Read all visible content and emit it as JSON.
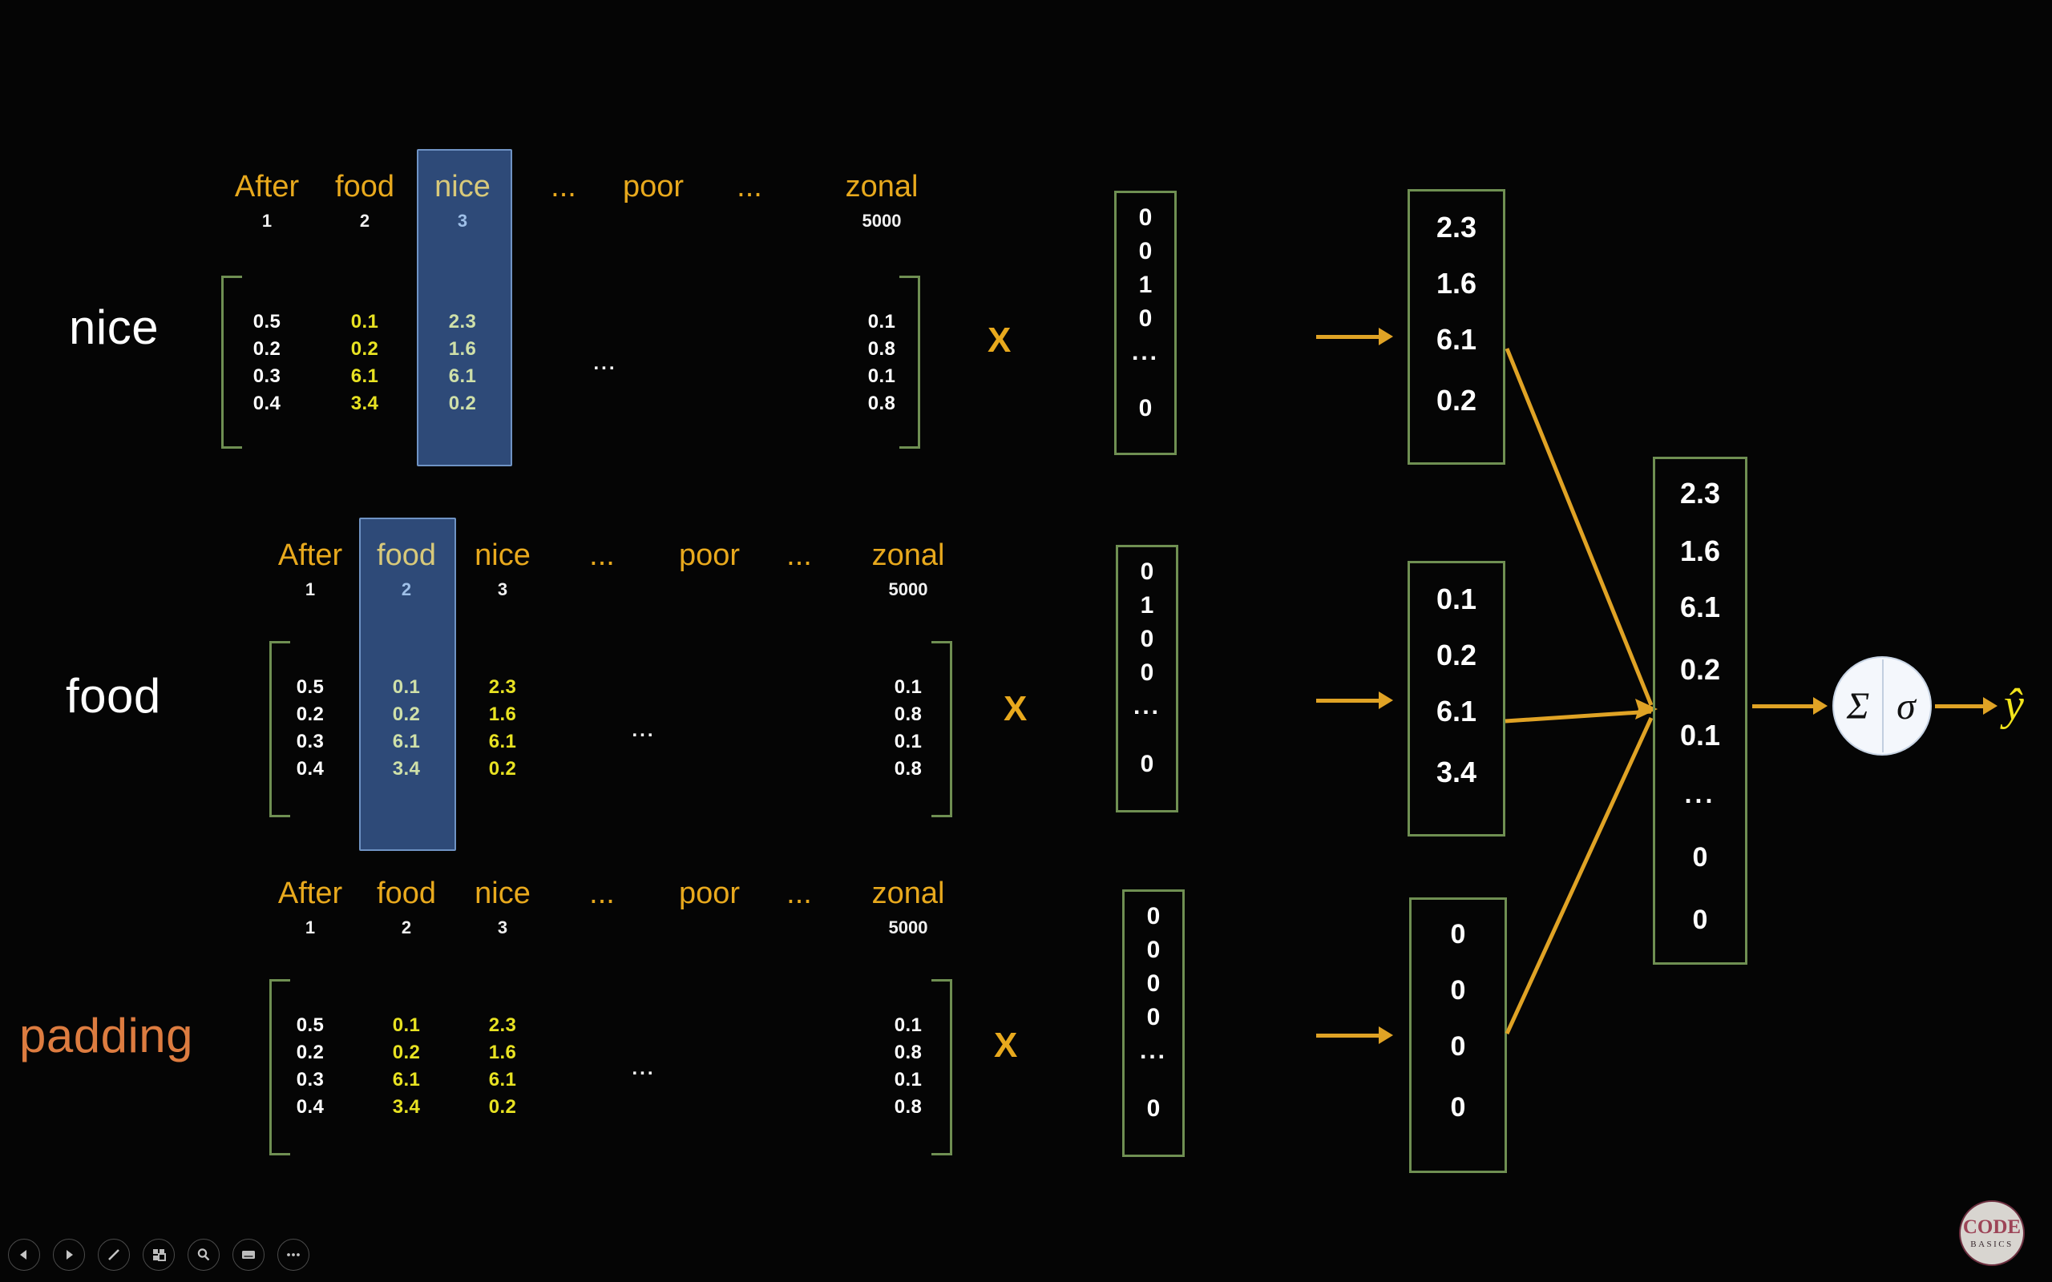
{
  "slide": {
    "background_color": "#000000",
    "accent_gold": "#e8a91d",
    "accent_yellow": "#e8e222",
    "bracket_green": "#6f8f52",
    "highlight_blue": "#2e4a78",
    "padding_orange": "#dd7c40"
  },
  "rows": [
    {
      "label": "nice",
      "label_color": "#ffffff",
      "highlight_index": 2,
      "headers": [
        {
          "word": "After",
          "index": "1"
        },
        {
          "word": "food",
          "index": "2"
        },
        {
          "word": "nice",
          "index": "3"
        },
        {
          "word": "...",
          "index": ""
        },
        {
          "word": "poor",
          "index": ""
        },
        {
          "word": "...",
          "index": ""
        },
        {
          "word": "zonal",
          "index": "5000"
        }
      ],
      "matrix": {
        "col_after": [
          "0.5",
          "0.2",
          "0.3",
          "0.4"
        ],
        "col_food": [
          "0.1",
          "0.2",
          "6.1",
          "3.4"
        ],
        "col_nice": [
          "2.3",
          "1.6",
          "6.1",
          "0.2"
        ],
        "ellipsis": "...",
        "col_zonal": [
          "0.1",
          "0.8",
          "0.1",
          "0.8"
        ]
      },
      "multiply_symbol": "X",
      "onehot": [
        "0",
        "0",
        "1",
        "0",
        "...",
        "0"
      ],
      "embedding": [
        "2.3",
        "1.6",
        "6.1",
        "0.2"
      ]
    },
    {
      "label": "food",
      "label_color": "#ffffff",
      "highlight_index": 1,
      "headers": [
        {
          "word": "After",
          "index": "1"
        },
        {
          "word": "food",
          "index": "2"
        },
        {
          "word": "nice",
          "index": "3"
        },
        {
          "word": "...",
          "index": ""
        },
        {
          "word": "poor",
          "index": ""
        },
        {
          "word": "...",
          "index": ""
        },
        {
          "word": "zonal",
          "index": "5000"
        }
      ],
      "matrix": {
        "col_after": [
          "0.5",
          "0.2",
          "0.3",
          "0.4"
        ],
        "col_food": [
          "0.1",
          "0.2",
          "6.1",
          "3.4"
        ],
        "col_nice": [
          "2.3",
          "1.6",
          "6.1",
          "0.2"
        ],
        "ellipsis": "...",
        "col_zonal": [
          "0.1",
          "0.8",
          "0.1",
          "0.8"
        ]
      },
      "multiply_symbol": "X",
      "onehot": [
        "0",
        "1",
        "0",
        "0",
        "...",
        "0"
      ],
      "embedding": [
        "0.1",
        "0.2",
        "6.1",
        "3.4"
      ]
    },
    {
      "label": "padding",
      "label_color": "#dd7c40",
      "highlight_index": -1,
      "headers": [
        {
          "word": "After",
          "index": "1"
        },
        {
          "word": "food",
          "index": "2"
        },
        {
          "word": "nice",
          "index": "3"
        },
        {
          "word": "...",
          "index": ""
        },
        {
          "word": "poor",
          "index": ""
        },
        {
          "word": "...",
          "index": ""
        },
        {
          "word": "zonal",
          "index": "5000"
        }
      ],
      "matrix": {
        "col_after": [
          "0.5",
          "0.2",
          "0.3",
          "0.4"
        ],
        "col_food": [
          "0.1",
          "0.2",
          "6.1",
          "3.4"
        ],
        "col_nice": [
          "2.3",
          "1.6",
          "6.1",
          "0.2"
        ],
        "ellipsis": "...",
        "col_zonal": [
          "0.1",
          "0.8",
          "0.1",
          "0.8"
        ]
      },
      "multiply_symbol": "X",
      "onehot": [
        "0",
        "0",
        "0",
        "0",
        "...",
        "0"
      ],
      "embedding": [
        "0",
        "0",
        "0",
        "0"
      ]
    }
  ],
  "concat_vector": [
    "2.3",
    "1.6",
    "6.1",
    "0.2",
    "0.1",
    "...",
    "0",
    "0"
  ],
  "neuron": {
    "sum_symbol": "Σ",
    "activation_symbol": "σ"
  },
  "output": {
    "label": "ŷ"
  },
  "toolbar": {
    "items": [
      {
        "name": "previous-slide-button",
        "icon": "triangle-left-icon"
      },
      {
        "name": "next-slide-button",
        "icon": "triangle-right-icon"
      },
      {
        "name": "pen-tool-button",
        "icon": "pen-icon"
      },
      {
        "name": "slide-overview-button",
        "icon": "grid-icon"
      },
      {
        "name": "zoom-button",
        "icon": "magnifier-icon"
      },
      {
        "name": "captions-button",
        "icon": "caption-icon"
      },
      {
        "name": "more-options-button",
        "icon": "ellipsis-icon"
      }
    ]
  },
  "logo": {
    "line1": "CODE",
    "line2": "BASICS"
  }
}
